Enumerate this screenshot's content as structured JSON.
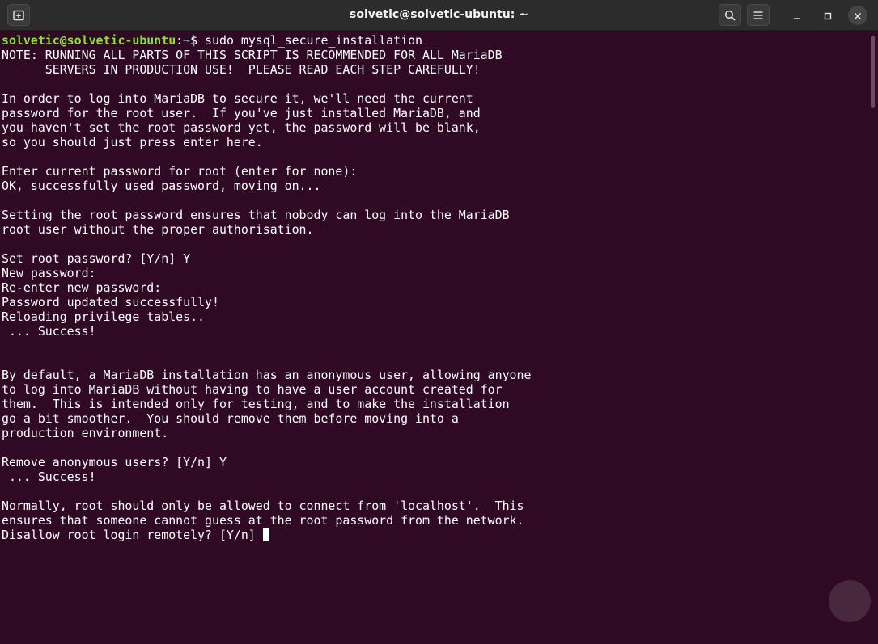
{
  "window": {
    "title": "solvetic@solvetic-ubuntu: ~"
  },
  "colors": {
    "terminal_bg": "#300a24",
    "titlebar_bg": "#2c2c2c",
    "prompt_user": "#8ae234",
    "prompt_path": "#729fcf",
    "text": "#ffffff"
  },
  "icons": {
    "new_tab": "new-tab-icon",
    "search": "search-icon",
    "menu": "hamburger-menu-icon",
    "minimize": "minimize-icon",
    "maximize": "maximize-icon",
    "close": "close-icon"
  },
  "terminal": {
    "prompt_user_host": "solvetic@solvetic-ubuntu",
    "prompt_colon": ":",
    "prompt_path": "~",
    "prompt_symbol": "$ ",
    "command": "sudo mysql_secure_installation",
    "output": "\nNOTE: RUNNING ALL PARTS OF THIS SCRIPT IS RECOMMENDED FOR ALL MariaDB\n      SERVERS IN PRODUCTION USE!  PLEASE READ EACH STEP CAREFULLY!\n\nIn order to log into MariaDB to secure it, we'll need the current\npassword for the root user.  If you've just installed MariaDB, and\nyou haven't set the root password yet, the password will be blank,\nso you should just press enter here.\n\nEnter current password for root (enter for none):\nOK, successfully used password, moving on...\n\nSetting the root password ensures that nobody can log into the MariaDB\nroot user without the proper authorisation.\n\nSet root password? [Y/n] Y\nNew password:\nRe-enter new password:\nPassword updated successfully!\nReloading privilege tables..\n ... Success!\n\n\nBy default, a MariaDB installation has an anonymous user, allowing anyone\nto log into MariaDB without having to have a user account created for\nthem.  This is intended only for testing, and to make the installation\ngo a bit smoother.  You should remove them before moving into a\nproduction environment.\n\nRemove anonymous users? [Y/n] Y\n ... Success!\n\nNormally, root should only be allowed to connect from 'localhost'.  This\nensures that someone cannot guess at the root password from the network.\n",
    "current_question": "Disallow root login remotely? [Y/n] "
  }
}
